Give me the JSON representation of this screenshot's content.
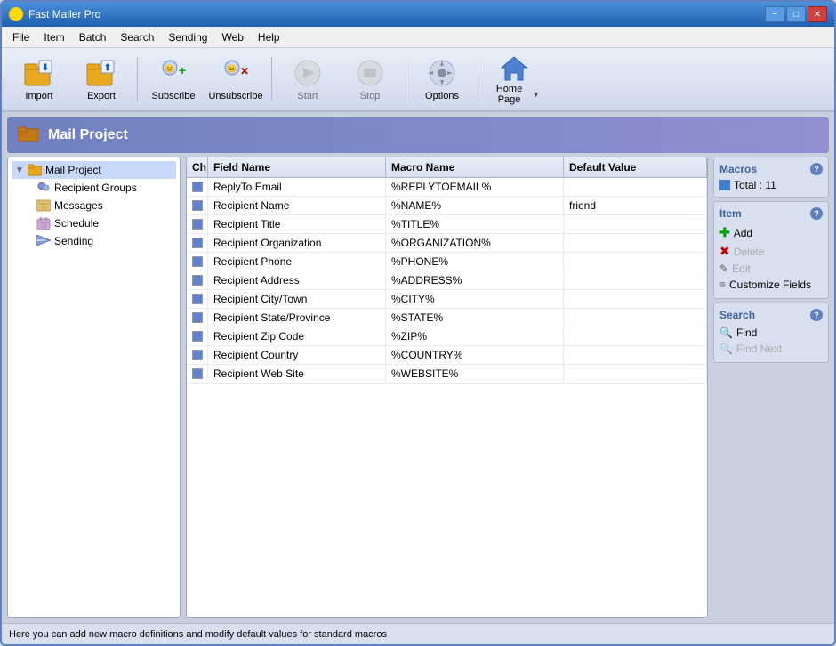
{
  "window": {
    "title": "Fast Mailer Pro",
    "minimize_label": "−",
    "maximize_label": "□",
    "close_label": "✕"
  },
  "menu": {
    "items": [
      "File",
      "Item",
      "Batch",
      "Search",
      "Sending",
      "Web",
      "Help"
    ]
  },
  "toolbar": {
    "buttons": [
      {
        "id": "import",
        "label": "Import",
        "disabled": false
      },
      {
        "id": "export",
        "label": "Export",
        "disabled": false
      },
      {
        "id": "subscribe",
        "label": "Subscribe",
        "disabled": false
      },
      {
        "id": "unsubscribe",
        "label": "Unsubscribe",
        "disabled": false
      },
      {
        "id": "start",
        "label": "Start",
        "disabled": true
      },
      {
        "id": "stop",
        "label": "Stop",
        "disabled": true
      },
      {
        "id": "options",
        "label": "Options",
        "disabled": false
      },
      {
        "id": "homepage",
        "label": "Home Page",
        "disabled": false
      }
    ]
  },
  "project": {
    "title": "Mail Project",
    "icon": "📁"
  },
  "tree": {
    "root": "Mail Project",
    "children": [
      "Recipient Groups",
      "Messages",
      "Schedule",
      "Sending"
    ]
  },
  "grid": {
    "headers": [
      "Ch",
      "Field Name",
      "Macro Name",
      "Default Value"
    ],
    "rows": [
      {
        "ch": true,
        "field": "ReplyTo Email",
        "macro": "%REPLYTOEMAIL%",
        "default": ""
      },
      {
        "ch": true,
        "field": "Recipient Name",
        "macro": "%NAME%",
        "default": "friend"
      },
      {
        "ch": true,
        "field": "Recipient Title",
        "macro": "%TITLE%",
        "default": ""
      },
      {
        "ch": true,
        "field": "Recipient Organization",
        "macro": "%ORGANIZATION%",
        "default": ""
      },
      {
        "ch": true,
        "field": "Recipient Phone",
        "macro": "%PHONE%",
        "default": ""
      },
      {
        "ch": true,
        "field": "Recipient Address",
        "macro": "%ADDRESS%",
        "default": ""
      },
      {
        "ch": true,
        "field": "Recipient City/Town",
        "macro": "%CITY%",
        "default": ""
      },
      {
        "ch": true,
        "field": "Recipient State/Province",
        "macro": "%STATE%",
        "default": ""
      },
      {
        "ch": true,
        "field": "Recipient Zip Code",
        "macro": "%ZIP%",
        "default": ""
      },
      {
        "ch": true,
        "field": "Recipient Country",
        "macro": "%COUNTRY%",
        "default": ""
      },
      {
        "ch": true,
        "field": "Recipient Web Site",
        "macro": "%WEBSITE%",
        "default": ""
      }
    ]
  },
  "macros_panel": {
    "title": "Macros",
    "total_label": "Total : 11"
  },
  "item_panel": {
    "title": "Item",
    "actions": [
      {
        "id": "add",
        "label": "Add",
        "disabled": false
      },
      {
        "id": "delete",
        "label": "Delete",
        "disabled": true
      },
      {
        "id": "edit",
        "label": "Edit",
        "disabled": true
      },
      {
        "id": "customize",
        "label": "Customize Fields",
        "disabled": false
      }
    ]
  },
  "search_panel": {
    "title": "Search",
    "actions": [
      {
        "id": "find",
        "label": "Find",
        "disabled": false
      },
      {
        "id": "findnext",
        "label": "Find Next",
        "disabled": true
      }
    ]
  },
  "statusbar": {
    "text": "Here you can add new macro definitions and modify default values for standard macros"
  }
}
